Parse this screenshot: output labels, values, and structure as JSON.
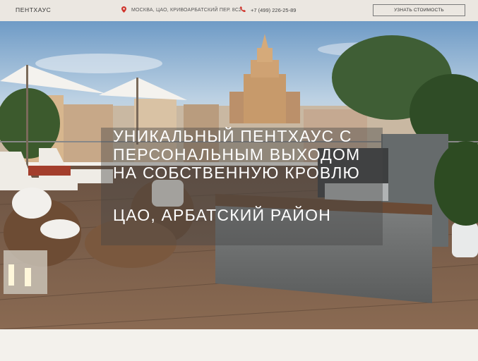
{
  "header": {
    "logo": "ПЕНТХАУС",
    "address": "МОСКВА, ЦАО, КРИВОАРБАТСКИЙ ПЕР. 8С2",
    "phone": "+7 (499) 226-25-89",
    "cta_label": "УЗНАТЬ СТОИМОСТЬ",
    "icon_color": "#d0342c"
  },
  "hero": {
    "headline": [
      "УНИКАЛЬНЫЙ  ПЕНТХАУС  С",
      "ПЕРСОНАЛЬНЫМ ВЫХОДОМ",
      "НА СОБСТВЕННУЮ КРОВЛЮ"
    ],
    "subline": "ЦАО, АРБАТСКИЙ РАЙОН"
  },
  "icons": {
    "location": "map-pin-icon",
    "phone": "phone-icon"
  }
}
